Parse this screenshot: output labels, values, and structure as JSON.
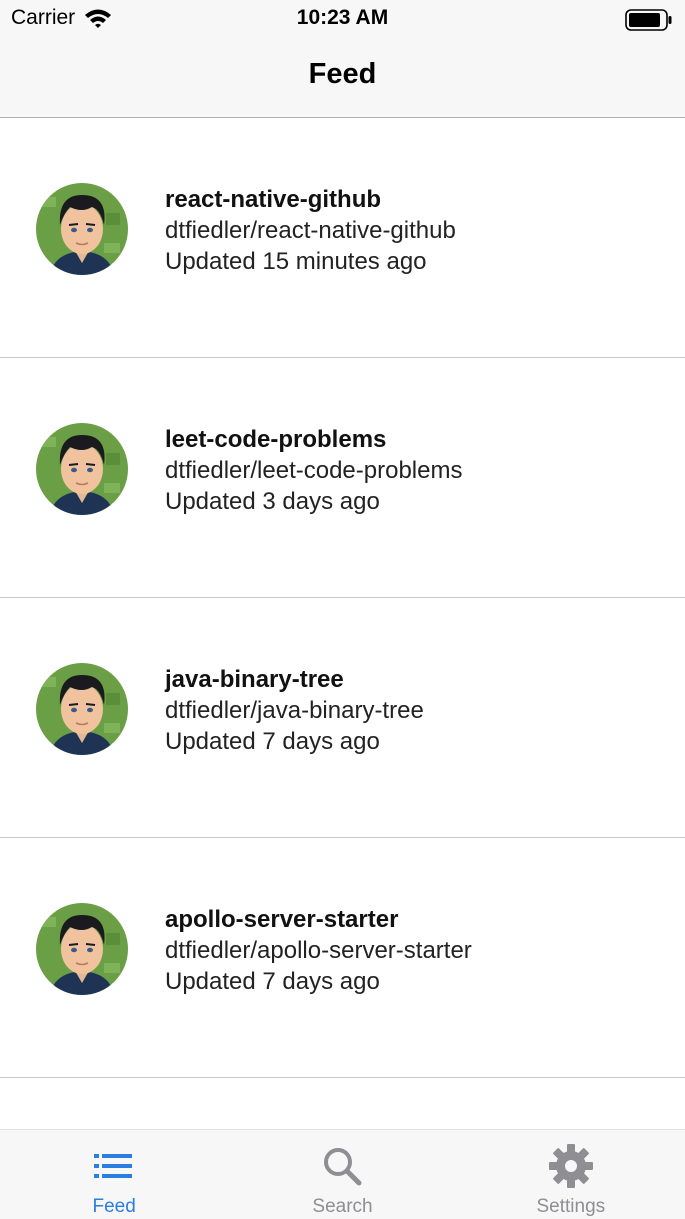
{
  "status_bar": {
    "carrier": "Carrier",
    "time": "10:23 AM"
  },
  "nav": {
    "title": "Feed"
  },
  "feed": [
    {
      "name": "react-native-github",
      "full_name": "dtfiedler/react-native-github",
      "updated": "Updated 15 minutes ago"
    },
    {
      "name": "leet-code-problems",
      "full_name": "dtfiedler/leet-code-problems",
      "updated": "Updated 3 days ago"
    },
    {
      "name": "java-binary-tree",
      "full_name": "dtfiedler/java-binary-tree",
      "updated": "Updated 7 days ago"
    },
    {
      "name": "apollo-server-starter",
      "full_name": "dtfiedler/apollo-server-starter",
      "updated": "Updated 7 days ago"
    }
  ],
  "tabs": [
    {
      "label": "Feed",
      "icon": "list-icon",
      "active": true
    },
    {
      "label": "Search",
      "icon": "search-icon",
      "active": false
    },
    {
      "label": "Settings",
      "icon": "gear-icon",
      "active": false
    }
  ],
  "colors": {
    "accent": "#2a7de1",
    "inactive": "#8e8e93",
    "bar_background": "#f7f7f7",
    "avatar_background": "#6a9f45"
  }
}
